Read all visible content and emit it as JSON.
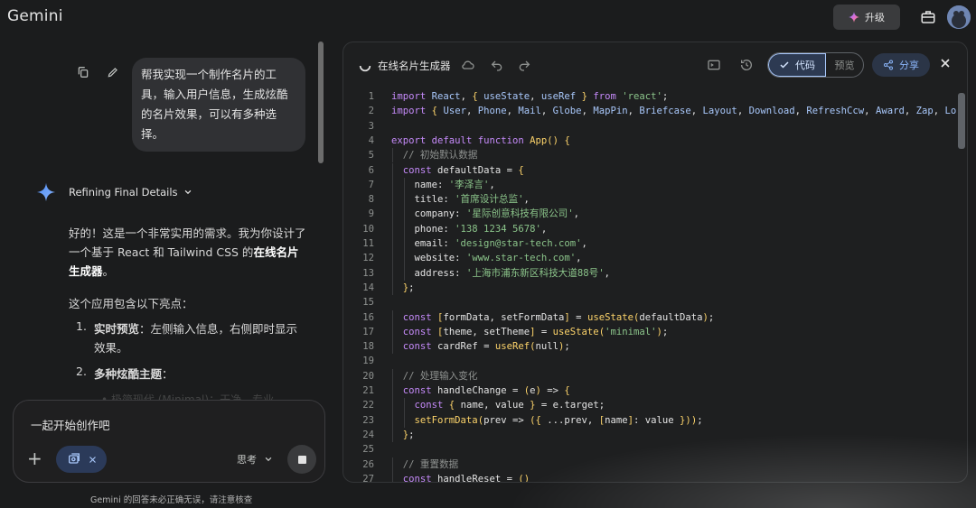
{
  "app": {
    "title": "Gemini",
    "upgrade_label": "升级"
  },
  "chat": {
    "user_message": "帮我实现一个制作名片的工具，输入用户信息，生成炫酷的名片效果，可以有多种选择。",
    "thinking_label": "Refining Final Details",
    "response_intro_a": "好的！这是一个非常实用的需求。我为你设计了一个基于 React 和 Tailwind CSS 的",
    "response_intro_bold": "在线名片生成器",
    "response_intro_end": "。",
    "highlights_intro": "这个应用包含以下亮点：",
    "list": [
      {
        "num": "1.",
        "bold": "实时预览",
        "text": "：左侧输入信息，右侧即时显示效果。"
      },
      {
        "num": "2.",
        "bold": "多种炫酷主题",
        "text": "："
      }
    ],
    "faded_sub": "• 极简现代 (Minimal)：干净、专业"
  },
  "composer": {
    "input_text": "一起开始创作吧",
    "mode_label": "思考",
    "disclaimer": "Gemini 的回答未必正确无误，请注意核查"
  },
  "panel": {
    "title": "在线名片生成器",
    "code_tab": "代码",
    "preview_tab": "预览",
    "share_label": "分享"
  },
  "code": {
    "lines": [
      "import React, { useState, useRef } from 'react';",
      "import { User, Phone, Mail, Globe, MapPin, Briefcase, Layout, Download, RefreshCcw, Award, Zap, Lo",
      "",
      "export default function App() {",
      "  // 初始默认数据",
      "  const defaultData = {",
      "    name: '李泽言',",
      "    title: '首席设计总监',",
      "    company: '星际创意科技有限公司',",
      "    phone: '138 1234 5678',",
      "    email: 'design@star-tech.com',",
      "    website: 'www.star-tech.com',",
      "    address: '上海市浦东新区科技大道88号',",
      "  };",
      "",
      "  const [formData, setFormData] = useState(defaultData);",
      "  const [theme, setTheme] = useState('minimal');",
      "  const cardRef = useRef(null);",
      "",
      "  // 处理输入变化",
      "  const handleChange = (e) => {",
      "    const { name, value } = e.target;",
      "    setFormData(prev => ({ ...prev, [name]: value }));",
      "  };",
      "",
      "  // 重置数据",
      "  const handleReset = ()"
    ]
  },
  "colors": {
    "background": "#1b1c1d",
    "accent": "#a8c7fa",
    "keyword": "#c58af9",
    "string": "#8bc48a",
    "function": "#fcd36a"
  }
}
